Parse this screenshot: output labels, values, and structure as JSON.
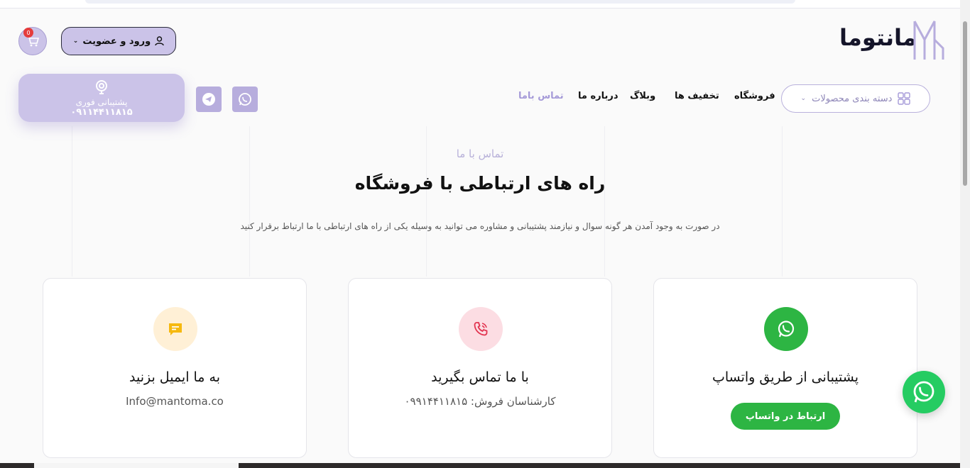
{
  "header": {
    "logo_text": "مانتوما",
    "cart_count": "0",
    "login_label": "ورود و عضویت"
  },
  "support_box": {
    "label": "پشتیبانی فوری",
    "phone": "۰۹۱۱۴۴۱۱۸۱۵"
  },
  "nav": {
    "categories_label": "دسته بندی محصولات",
    "items": [
      "فروشگاه",
      "تخفیف ها",
      "وبلاگ",
      "درباره ما",
      "تماس باما"
    ]
  },
  "hero": {
    "subtitle": "تماس با ما",
    "title": "راه های ارتباطی با فروشگاه",
    "description": "در صورت به وجود آمدن هر گونه سوال و نیازمند پشتیبانی و مشاوره می توانید به وسیله یکی از راه های ارتباطی با ما ارتباط برقرار کنید"
  },
  "cards": {
    "whatsapp": {
      "title": "پشتیبانی از طریق واتساپ",
      "button": "ارتباط در واتساپ",
      "icon": "whatsapp-icon"
    },
    "phone": {
      "title": "با ما تماس بگیرید",
      "desc": "کارشناسان فروش: ۰۹۹۱۴۴۱۱۸۱۵",
      "icon": "phone-icon"
    },
    "email": {
      "title": "به ما ایمیل بزنید",
      "desc": "Info@mantoma.co",
      "icon": "chat-message-icon"
    }
  },
  "colors": {
    "accent": "#cbc3e8",
    "whatsapp": "#2db543",
    "phone_bg": "#fcdde3",
    "email_bg": "#fff0d6"
  }
}
